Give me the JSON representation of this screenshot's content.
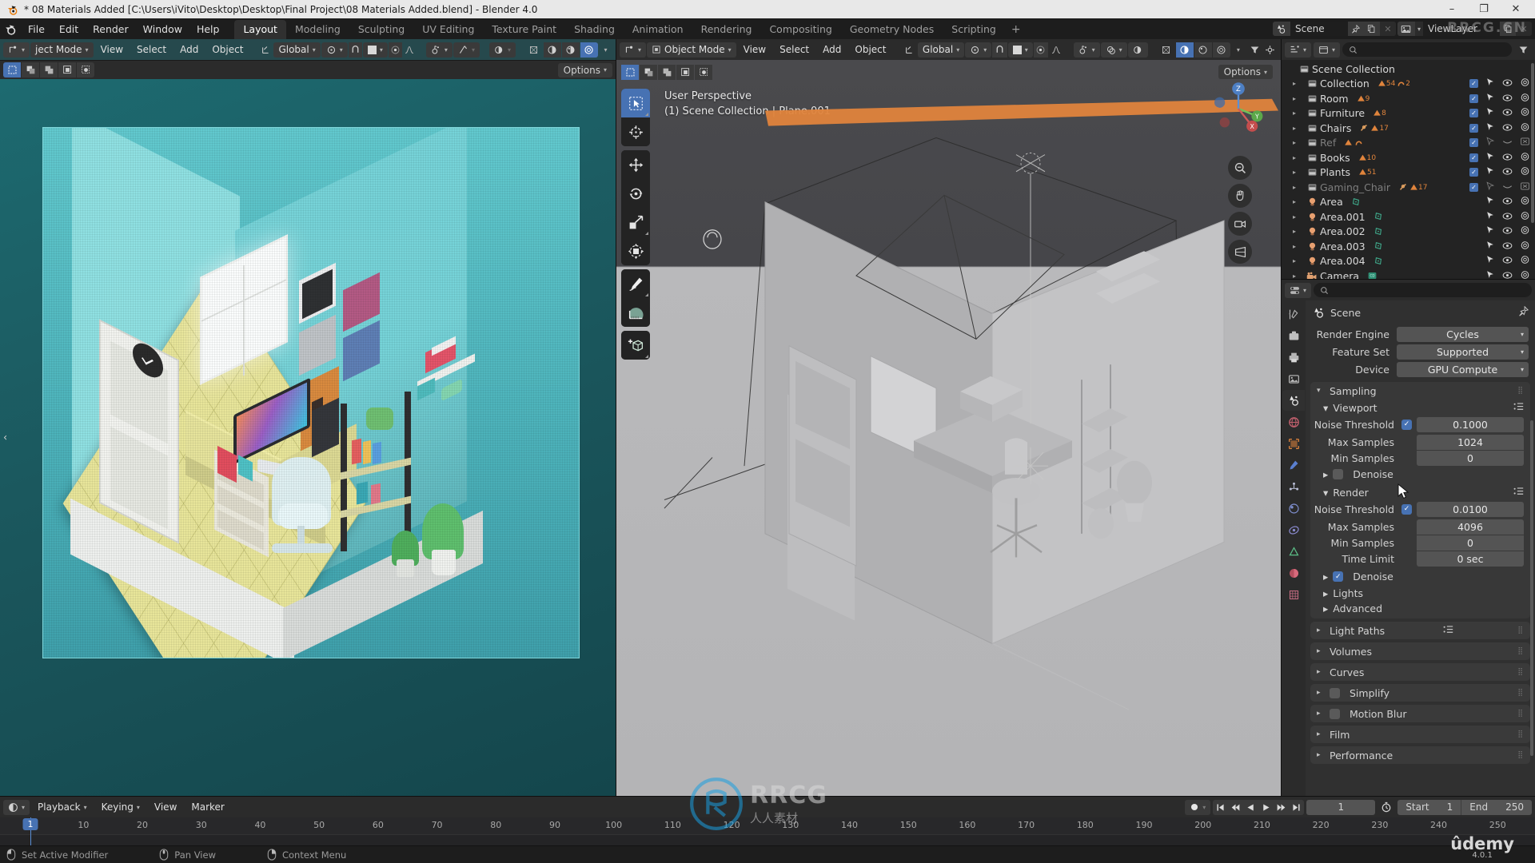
{
  "window": {
    "title": "* 08 Materials Added [C:\\Users\\iVito\\Desktop\\Desktop\\Final Project\\08 Materials Added.blend] - Blender 4.0",
    "minimize": "–",
    "maximize": "❐",
    "close": "✕"
  },
  "topbar": {
    "menus": [
      "File",
      "Edit",
      "Render",
      "Window",
      "Help"
    ],
    "workspaces": [
      {
        "label": "Layout",
        "active": true
      },
      {
        "label": "Modeling",
        "active": false
      },
      {
        "label": "Sculpting",
        "active": false
      },
      {
        "label": "UV Editing",
        "active": false
      },
      {
        "label": "Texture Paint",
        "active": false
      },
      {
        "label": "Shading",
        "active": false
      },
      {
        "label": "Animation",
        "active": false
      },
      {
        "label": "Rendering",
        "active": false
      },
      {
        "label": "Compositing",
        "active": false
      },
      {
        "label": "Geometry Nodes",
        "active": false
      },
      {
        "label": "Scripting",
        "active": false
      }
    ],
    "add_workspace": "+",
    "scene_name": "Scene",
    "viewlayer_name": "ViewLayer"
  },
  "left_viewport": {
    "mode": "ject Mode",
    "menus": [
      "View",
      "Select",
      "Add",
      "Object"
    ],
    "transform_orientation": "Global",
    "options_label": "Options"
  },
  "solid_viewport": {
    "mode": "Object Mode",
    "menus": [
      "View",
      "Select",
      "Add",
      "Object"
    ],
    "transform_orientation": "Global",
    "options_label": "Options",
    "overlay_line1": "User Perspective",
    "overlay_line2": "(1) Scene Collection | Plane.001",
    "tools": [
      "tweak-select-tool",
      "cursor-tool",
      "move-tool",
      "rotate-tool",
      "scale-tool",
      "transform-tool",
      "annotate-tool",
      "measure-tool",
      "add-cube-tool"
    ],
    "gizmo_axes": [
      "X",
      "Y",
      "Z"
    ]
  },
  "outliner": {
    "root": "Scene Collection",
    "rows": [
      {
        "name": "Collection",
        "icon": "collection-icon",
        "counts": [
          "54",
          "2"
        ],
        "count_icons": [
          "mesh",
          "curve"
        ],
        "checkbox": true,
        "dim": false
      },
      {
        "name": "Room",
        "icon": "collection-icon",
        "counts": [
          "9"
        ],
        "count_icons": [
          "mesh"
        ],
        "checkbox": true,
        "dim": false
      },
      {
        "name": "Furniture",
        "icon": "collection-icon",
        "counts": [
          "8"
        ],
        "count_icons": [
          "mesh"
        ],
        "checkbox": true,
        "dim": false
      },
      {
        "name": "Chairs",
        "icon": "collection-icon",
        "counts": [
          "",
          "17"
        ],
        "count_icons": [
          "armature",
          "mesh"
        ],
        "checkbox": true,
        "dim": false
      },
      {
        "name": "Ref",
        "icon": "collection-icon",
        "counts": [
          "",
          ""
        ],
        "count_icons": [
          "mesh",
          "curve"
        ],
        "checkbox": true,
        "dim": true
      },
      {
        "name": "Books",
        "icon": "collection-icon",
        "counts": [
          "10"
        ],
        "count_icons": [
          "mesh"
        ],
        "checkbox": true,
        "dim": false
      },
      {
        "name": "Plants",
        "icon": "collection-icon",
        "counts": [
          "51"
        ],
        "count_icons": [
          "mesh"
        ],
        "checkbox": true,
        "dim": false
      },
      {
        "name": "Gaming_Chair",
        "icon": "collection-icon",
        "counts": [
          "",
          "17"
        ],
        "count_icons": [
          "armature",
          "mesh"
        ],
        "checkbox": true,
        "dim": true
      },
      {
        "name": "Area",
        "icon": "light-icon",
        "counts": [],
        "count_icons": [
          "lightdata"
        ],
        "checkbox": false,
        "dim": false
      },
      {
        "name": "Area.001",
        "icon": "light-icon",
        "counts": [],
        "count_icons": [
          "lightdata"
        ],
        "checkbox": false,
        "dim": false
      },
      {
        "name": "Area.002",
        "icon": "light-icon",
        "counts": [],
        "count_icons": [
          "lightdata"
        ],
        "checkbox": false,
        "dim": false
      },
      {
        "name": "Area.003",
        "icon": "light-icon",
        "counts": [],
        "count_icons": [
          "lightdata"
        ],
        "checkbox": false,
        "dim": false
      },
      {
        "name": "Area.004",
        "icon": "light-icon",
        "counts": [],
        "count_icons": [
          "lightdata"
        ],
        "checkbox": false,
        "dim": false
      },
      {
        "name": "Camera",
        "icon": "camera-icon",
        "counts": [],
        "count_icons": [
          "cameradata"
        ],
        "checkbox": false,
        "dim": false
      }
    ]
  },
  "properties": {
    "breadcrumb": "Scene",
    "tabs": [
      "tool-tab",
      "render-tab",
      "output-tab",
      "viewlayer-tab",
      "scene-tab",
      "world-tab",
      "object-tab",
      "modifier-tab",
      "particles-tab",
      "physics-tab",
      "constraints-tab",
      "data-tab",
      "material-tab",
      "texture-tab"
    ],
    "active_tab": "scene-tab",
    "render_engine_label": "Render Engine",
    "render_engine_value": "Cycles",
    "feature_set_label": "Feature Set",
    "feature_set_value": "Supported",
    "device_label": "Device",
    "device_value": "GPU Compute",
    "sampling": {
      "title": "Sampling",
      "viewport": {
        "title": "Viewport",
        "noise_threshold_label": "Noise Threshold",
        "noise_threshold_enabled": true,
        "noise_threshold_value": "0.1000",
        "max_samples_label": "Max Samples",
        "max_samples_value": "1024",
        "min_samples_label": "Min Samples",
        "min_samples_value": "0",
        "denoise_label": "Denoise",
        "denoise_enabled": false
      },
      "render": {
        "title": "Render",
        "noise_threshold_label": "Noise Threshold",
        "noise_threshold_enabled": true,
        "noise_threshold_value": "0.0100",
        "max_samples_label": "Max Samples",
        "max_samples_value": "4096",
        "min_samples_label": "Min Samples",
        "min_samples_value": "0",
        "time_limit_label": "Time Limit",
        "time_limit_value": "0 sec",
        "denoise_label": "Denoise",
        "denoise_enabled": true,
        "lights_label": "Lights",
        "advanced_label": "Advanced"
      }
    },
    "panels": [
      {
        "label": "Light Paths",
        "checkbox": null
      },
      {
        "label": "Volumes",
        "checkbox": null
      },
      {
        "label": "Curves",
        "checkbox": null
      },
      {
        "label": "Simplify",
        "checkbox": false
      },
      {
        "label": "Motion Blur",
        "checkbox": false
      },
      {
        "label": "Film",
        "checkbox": null
      },
      {
        "label": "Performance",
        "checkbox": null
      }
    ]
  },
  "timeline": {
    "menus": [
      "Playback",
      "Keying",
      "View",
      "Marker"
    ],
    "current_frame": "1",
    "start_label": "Start",
    "start_value": "1",
    "end_label": "End",
    "end_value": "250",
    "ticks": [
      1,
      10,
      20,
      30,
      40,
      50,
      60,
      70,
      80,
      90,
      100,
      110,
      120,
      130,
      140,
      150,
      160,
      170,
      180,
      190,
      200,
      210,
      220,
      230,
      240,
      250
    ],
    "playhead_frame": 1
  },
  "statusbar": {
    "items": [
      {
        "icon": "mouse-left-icon",
        "label": "Set Active Modifier"
      },
      {
        "icon": "mouse-middle-icon",
        "label": "Pan View"
      },
      {
        "icon": "mouse-right-icon",
        "label": "Context Menu"
      }
    ]
  },
  "watermarks": {
    "rrcg_main": "RRCG",
    "rrcg_sub": "人人素材",
    "rrcg_top": "RRCG.CN",
    "udemy": "ûdemy",
    "version": "4.0.1"
  },
  "colors": {
    "accent_blue": "#4772b3",
    "outliner_orange": "#e0843c",
    "teal_viewport": "#1d6a70",
    "panel_bg": "#303030",
    "header_bg": "#2b2b2b"
  }
}
